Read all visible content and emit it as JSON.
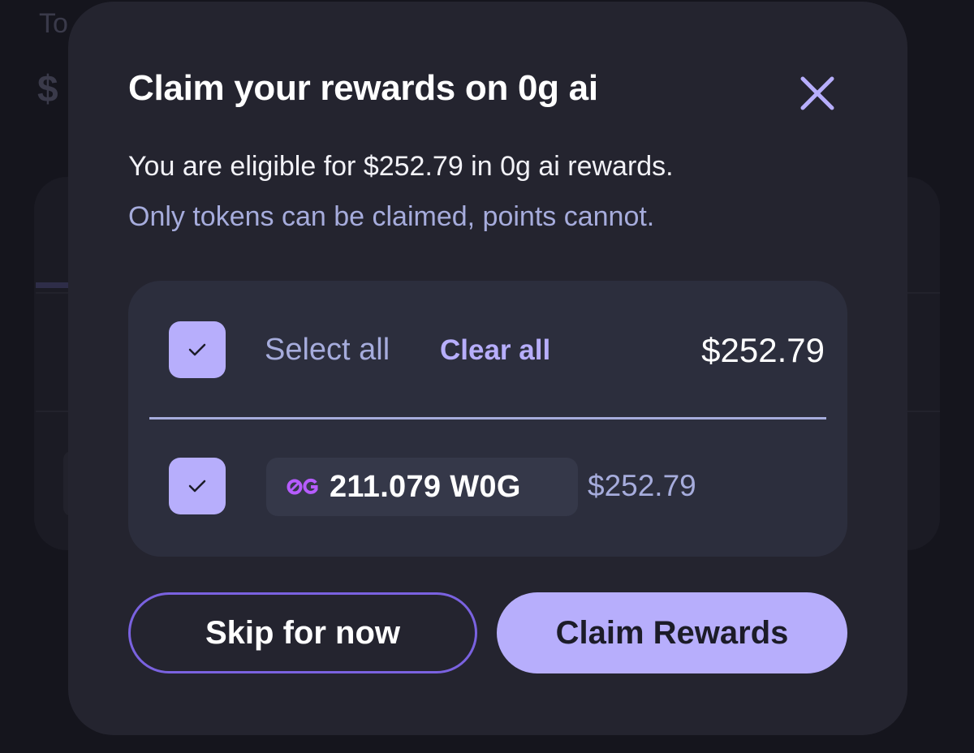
{
  "background": {
    "total_label": "To",
    "total_value": "$"
  },
  "modal": {
    "title": "Claim your rewards on 0g ai",
    "close_icon": "close-icon",
    "description": "You are eligible for $252.79 in 0g ai rewards.",
    "note": "Only tokens can be claimed, points cannot.",
    "select_all_label": "Select all",
    "clear_all_label": "Clear all",
    "total_amount": "$252.79",
    "select_all_checked": true,
    "tokens": [
      {
        "icon": "0g-token-icon",
        "amount_label": "211.079 W0G",
        "value": "$252.79",
        "checked": true
      }
    ],
    "skip_button": "Skip for now",
    "claim_button": "Claim Rewards"
  },
  "colors": {
    "accent": "#b7aefc",
    "secondary_text": "#a6acdc",
    "modal_bg": "#24242f",
    "panel_bg": "#2c2e3d",
    "outline": "#7a62e0"
  }
}
